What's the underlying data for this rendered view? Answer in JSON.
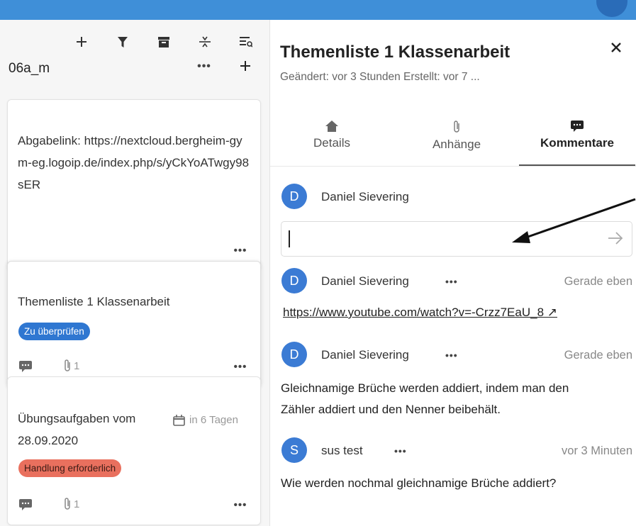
{
  "stack": {
    "title": "06a_m",
    "more_label": "•••"
  },
  "cards": [
    {
      "text": "Abgabelink: https://nextcloud.bergheim-gym-eg.logoip.de/index.php/s/yCkYoATwgy98sER",
      "more": "•••"
    },
    {
      "text": "Themenliste 1 Klassenarbeit",
      "badge": "Zu überprüfen",
      "attachments": "1",
      "more": "•••"
    },
    {
      "text": "Übungsaufgaben vom 28.09.2020",
      "due": "in 6 Tagen",
      "badge": "Handlung erforderlich",
      "attachments": "1",
      "more": "•••"
    }
  ],
  "detail": {
    "title": "Themenliste 1 Klassenarbeit",
    "subtitle": "Geändert: vor 3 Stunden Erstellt: vor 7 ...",
    "tabs": [
      {
        "label": "Details",
        "icon": "home-icon"
      },
      {
        "label": "Anhänge",
        "icon": "paperclip-icon"
      },
      {
        "label": "Kommentare",
        "icon": "comment-icon"
      }
    ],
    "current_user": {
      "initial": "D",
      "name": "Daniel Sievering"
    },
    "comment_input": {
      "value": ""
    },
    "comments": [
      {
        "initial": "D",
        "author": "Daniel Sievering",
        "more": "•••",
        "time": "Gerade eben",
        "text": "https://www.youtube.com/watch?v=-Crzz7EaU_8 ↗"
      },
      {
        "initial": "D",
        "author": "Daniel Sievering",
        "more": "•••",
        "time": "Gerade eben",
        "text_line1": "Gleichnamige Brüche werden addiert, indem man den",
        "text_line2": "Zähler addiert und den Nenner beibehält."
      },
      {
        "initial": "S",
        "author": "sus test",
        "more": "•••",
        "time": "vor 3 Minuten",
        "text": "Wie werden nochmal gleichnamige Brüche addiert?"
      }
    ]
  },
  "colors": {
    "topbar": "#3f8fd8",
    "badge_blue": "#2f77d1",
    "badge_red": "#e9705e",
    "avatar": "#3b7bd4"
  }
}
